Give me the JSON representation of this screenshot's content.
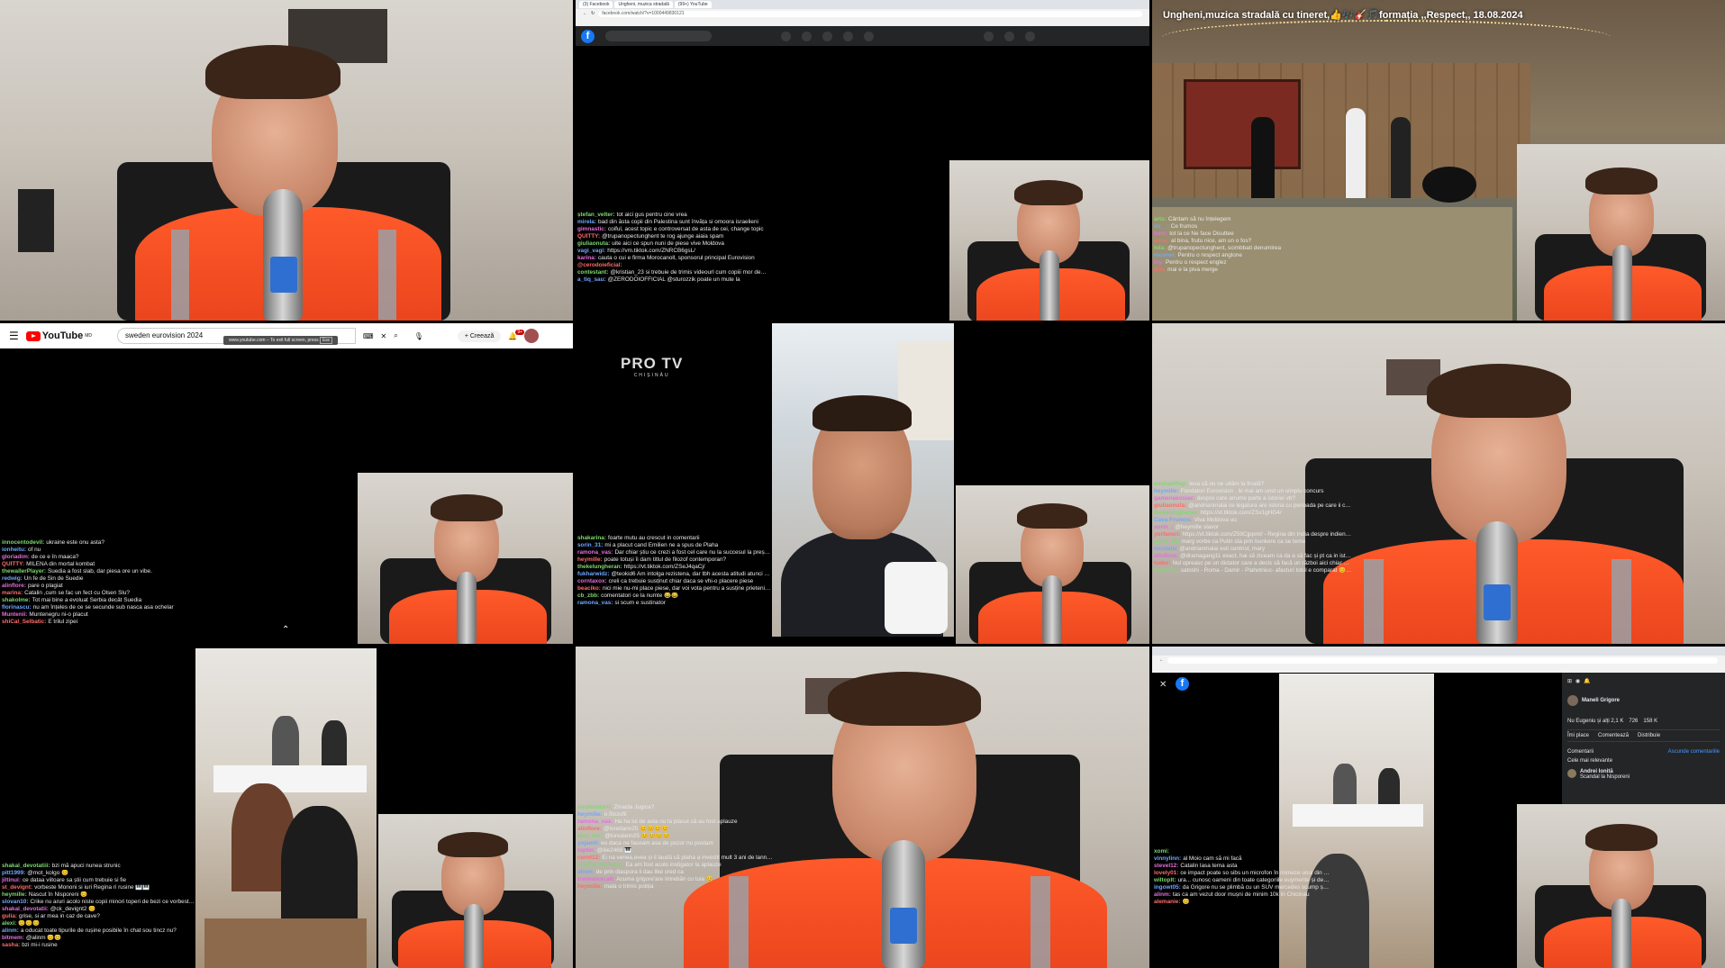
{
  "cells": {
    "c2": {
      "browser_tabs": [
        "(3) Facebook",
        "Ungheni, muzica stradală",
        "(99+) YouTube"
      ],
      "url": "facebook.com/watch/?v=1000449830121"
    },
    "c3": {
      "video_title": "Ungheni,muzica stradală cu tineret,👍🎶🎸🎵formația ,,Respect,, 18.08.2024"
    },
    "c4": {
      "youtube": {
        "logo": "YouTube",
        "region": "MD",
        "search_value": "sweden eurovision 2024",
        "create_label": "Creează",
        "notif_count": "9+",
        "fullscreen_hint": "www.youtube.com – To exit full screen, press",
        "fullscreen_key": "Esc"
      }
    },
    "c5": {
      "channel": "PRO TV",
      "channel_sub": "CHIȘINĂU"
    },
    "c9": {
      "post_author": "Maneli Grigore",
      "reactions": "Nu Eugeniu și alți 2,1 K",
      "comments_count": "726",
      "shares_count": "158 K",
      "like_label": "Îmi place",
      "comment_label": "Comentează",
      "share_label": "Distribuie",
      "comments_header": "Comentarii",
      "hide_comments": "Ascunde comentariile",
      "sort_label": "Cele mai relevante",
      "commenter": "Andrei Ionită",
      "comment_text": "Scandal la Nisporeni"
    }
  },
  "chats": {
    "c2": [
      [
        "ștefan_velter",
        "tot aici gus pentru cine vrea"
      ],
      [
        "mirela",
        "bad din ăsta copii din Palestina sunt învăța si omoora israelieni"
      ],
      [
        "gimnastic",
        "coiful, acest topic e controversat de asta de cei, change topic"
      ],
      [
        "QUITTY",
        "@trupanopectunghent te rog ajunge aiaia spam"
      ],
      [
        "giuliaonuta",
        "uite aici ce spun nuni de piese vive Moldova"
      ],
      [
        "vagi_vagi",
        "https://vm.tiktok.com/ZNRCB6gsL/"
      ],
      [
        "karina",
        "cauta o cui e firma Morocanoll, sponsorul principal Eurovision"
      ],
      [
        "@cerodoieficial",
        ""
      ],
      [
        "contestant",
        "@kristian_23 si trebuie de trimis videourl cum copiii mor de bombe si cum Israelul bombardează SPITALE plina de oameni si copii"
      ],
      [
        "a_tiq_sau",
        "@ZERODOIOFFICIAL @sturozzik poate un mute la"
      ]
    ],
    "c3": [
      [
        "arts",
        "Cântam să nu înțelegem"
      ],
      [
        "vu__",
        "Ce frumos"
      ],
      [
        "lumi",
        "tot la ce Ne face Disuttee"
      ],
      [
        "anne",
        "al bina, frutu nice, am un o fos?"
      ],
      [
        "lola",
        "@trupanopectunghent, scimbbati denumirea"
      ],
      [
        "niconel",
        "Pentru o respect anglone"
      ],
      [
        "kiy",
        "Pentru o respect englez"
      ],
      [
        "alin",
        "mai e la piva merge"
      ]
    ],
    "c4": [
      [
        "innocentodevil",
        "ukraine este onu asta?"
      ],
      [
        "ionheitu",
        "of nu"
      ],
      [
        "gloriadim",
        "de ce e în maaca?"
      ],
      [
        "QUITTY",
        "MILENA din mortal kombat"
      ],
      [
        "thewallerPlayer",
        "Suedia a fost slab, dar piesa ore un vibe."
      ],
      [
        "redwig",
        "Un fe de Sin de Suedie"
      ],
      [
        "alinflore",
        "pare o plagiat"
      ],
      [
        "marina",
        "Catalin ,cum se fac un fect cu Olsen Slu?"
      ],
      [
        "shakolme",
        "Tot mai bine a evoluat Serbia decât Suedia"
      ],
      [
        "florinascu",
        "nu am înțeles de ce se secunde sub nasca asa ochelar"
      ],
      [
        "Muntenii",
        "Muntenegru ni-o placut"
      ],
      [
        "shiCal_Selbatic",
        "E trilul zipei"
      ]
    ],
    "c5": [
      [
        "shakarina",
        "foarte mutu au crescut in comentarii"
      ],
      [
        "sorin_31",
        "mi a placut cand Emilien ne a spus de Plaha"
      ],
      [
        "ramona_vas",
        "Dar chiar știu ce crezi a fost cel care nu la succesul la președintia moldovei"
      ],
      [
        "heymille",
        "poate totuși îi dam titlul de filozof contemporan?"
      ],
      [
        "thekelungheran",
        "https://vt.tiktok.com/ZSeJ4qaCj/"
      ],
      [
        "fukharwidz",
        "@teokid6 Am intolga rezistena, dar tbh acesta atitudi atunci si scum tot 😊 why bring it up?!"
      ],
      [
        "corntaxox",
        "creli ca trebuie susținut chiar daca se vhi-o placere piese"
      ],
      [
        "beaciko",
        "nici mie nu-mi place piese, dar voi vota pentru a susține prietenie dirit"
      ],
      [
        "cb_zbb",
        "comentatori ce la numte 😂😂"
      ],
      [
        "ramona_vas",
        "si scum e sustinator"
      ]
    ],
    "c6": [
      [
        "michaelflap",
        "leva cã nu ne uităm la finală?"
      ],
      [
        "heymille",
        "Fondatori Eurovision , bi mai am unst un simplu concurs"
      ],
      [
        "gamenaessiax",
        "despre care anume parte a istoriei vb?"
      ],
      [
        "giuliaonuta",
        "@andrianmalai ce legatura are istoria cu perioada pe care ii comit ?"
      ],
      [
        "thekelungheran",
        "https://vt.tiktok.com/ZSx1gHG4/"
      ],
      [
        "Cava Frumos",
        "Viva Moldova uu"
      ],
      [
        "sorin_",
        "@heymille slavor"
      ],
      [
        "yorfavori",
        "https://vt.tiktok.com/Z59Cjppml/ - Regina din India despre indieni în Moldova"
      ],
      [
        "sorin_31",
        "marg vorbe ca Putin sta prin bunkere ca se teme"
      ],
      [
        "nicoleta",
        "@andrianmalai esti centrist, mary"
      ],
      [
        "alinflore",
        "@dramagang11 exact, hai să ziceam ca da a să fac și pt ca in istorieee nu stiu ce a fost"
      ],
      [
        "tudor",
        "Nul opreasc pe un dictator care a decis să facă un război aici chiar așa suav"
      ],
      [
        "heymille",
        "satoshi - Roma - Damir - Plahotniuc- afacturi totul e comparat 😊😊"
      ]
    ],
    "c7": [
      [
        "shakal_devotatiii",
        "bzi mă apuci nunea strunic"
      ],
      [
        "pitt1999",
        "@mot_kolgo 😊"
      ],
      [
        "jiltinui",
        "ce dataa viitoare sa știi cum trebuie si fie"
      ],
      [
        "st_devignt",
        "vorbeste Mononi si iuri Regina ri rusine 🎹🎹"
      ],
      [
        "heymille",
        "Nascut în Nisporeni 😊"
      ],
      [
        "slovan10",
        "Crike nu aruri acolo niste copii minori toperi de bezi ce vorbesti lol"
      ],
      [
        "shakal_devotatii",
        "@ck_devignt2 😊"
      ],
      [
        "gulia",
        "grise, si ar mea in caz de cave?"
      ],
      [
        "alexi",
        "😊😊😊"
      ],
      [
        "alinm",
        "a oducat toate tipurile de rușine posibile în chat sou tincz nu?"
      ],
      [
        "bitmem",
        "@alinm 😊😊"
      ],
      [
        "sasha",
        "bzi mi-i rusine"
      ]
    ],
    "c8": [
      [
        "sustenatorii",
        "Zinaida Jugica?"
      ],
      [
        "heymille",
        "o filozofii"
      ],
      [
        "ramona_vas",
        "Ha ha lui de asta nu la placut că au fost aplauze"
      ],
      [
        "alinflore",
        "@loredann25 😊😊😊😊"
      ],
      [
        "alex_dor",
        "@loredann25 😊😊😊😊"
      ],
      [
        "yojamil",
        "eu daca ne faceam asa de pozor nu postam"
      ],
      [
        "toptin",
        "@ilie2468 🎹"
      ],
      [
        "cornt12",
        "Ei na venea,evea și il laudă că plaha a investit mult 3 ani de lanna cu poveste în Nisporeni,cintareti din Romania gratis avea să-i laude crede-mă"
      ],
      [
        "shuCal_Selbatic",
        "Ea am fost acolo instigator la aplauze"
      ],
      [
        "alinm",
        "de prin diaspora ii dau like cred ca"
      ],
      [
        "treimatescall",
        "Acuma grigore'are întrebări cu tuia 😊"
      ],
      [
        "heymille",
        "mala o trimis poliția"
      ]
    ],
    "c9": [
      [
        "xomi",
        ""
      ],
      [
        "vinnylinn",
        "al Moio cam să mi facă"
      ],
      [
        "stevel12",
        "Catalin lasa tema asta"
      ],
      [
        "lovely01",
        "ce impact poate so sibs un microfon în mimeze unui din fara studii si care nu se pricepe cum funcționează un stat"
      ],
      [
        "wiltoplt",
        "ura... cunosc oameni din toate categoriile euymerite și de tine și de Manole și situasii... cunosc oameni care din vina cu costa mult poteece, reparație e tare tare greu să faci rost de un sac și vinsu trece pe lângă tine"
      ],
      [
        "ingowt05",
        "da Grigore nu se plimbă cu un SUV mercedes scump și merge despre ce el vorbește.."
      ],
      [
        "alinm",
        "tas ca am vezut door mușni de minim 10k în Chicinau"
      ],
      [
        "alemanie",
        "😊"
      ]
    ]
  },
  "colors": {
    "orange_shirt": "#ff5a2a",
    "facebook_blue": "#1877f2",
    "youtube_red": "#ff0000",
    "chat_user_green": "#7dd96f",
    "chat_user_blue": "#6fa8ff",
    "chat_user_pink": "#e46fdc",
    "chat_user_red": "#ff6b6b"
  }
}
